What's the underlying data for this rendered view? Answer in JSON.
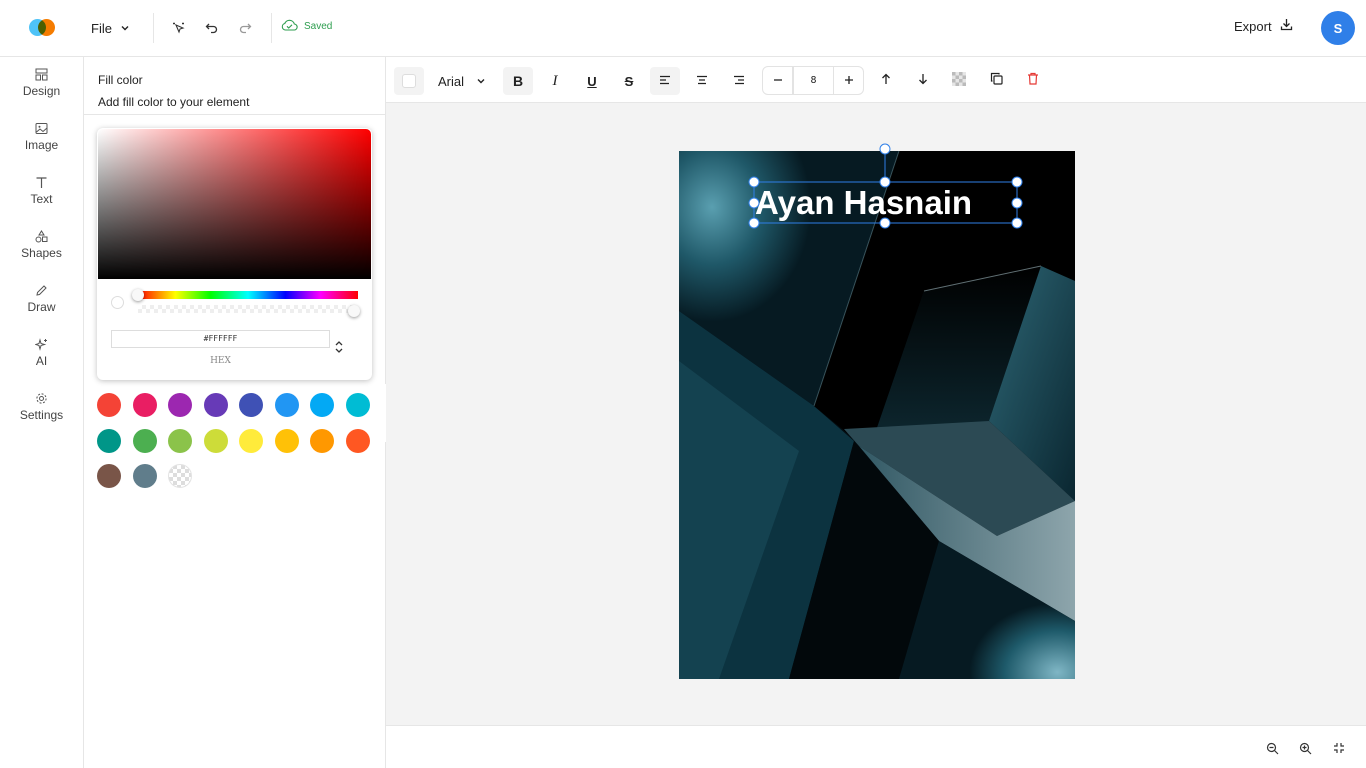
{
  "header": {
    "file_label": "File",
    "saved_label": "Saved",
    "export_label": "Export",
    "avatar_initial": "S"
  },
  "nav": {
    "items": [
      {
        "label": "Design",
        "icon": "layout-icon"
      },
      {
        "label": "Image",
        "icon": "image-icon"
      },
      {
        "label": "Text",
        "icon": "text-icon"
      },
      {
        "label": "Shapes",
        "icon": "shapes-icon"
      },
      {
        "label": "Draw",
        "icon": "pencil-icon"
      },
      {
        "label": "AI",
        "icon": "sparkles-icon"
      },
      {
        "label": "Settings",
        "icon": "gear-icon"
      }
    ]
  },
  "panel": {
    "title": "Fill color",
    "subtitle": "Add fill color to your element",
    "picker": {
      "hex_value": "#FFFFFF",
      "hex_label": "HEX",
      "hue_color": "#ff0000"
    },
    "swatches": [
      "#f44336",
      "#e91e63",
      "#9c27b0",
      "#673ab7",
      "#3f51b5",
      "#2196f3",
      "#03a9f4",
      "#00bcd4",
      "#009688",
      "#4caf50",
      "#8bc34a",
      "#cddc39",
      "#ffeb3b",
      "#ffc107",
      "#ff9800",
      "#ff5722",
      "#795548",
      "#607d8b",
      "transparent"
    ]
  },
  "toolbar": {
    "font_family": "Arial",
    "font_size": "8"
  },
  "canvas": {
    "text": "Ayan Hasnain",
    "text_color": "#ffffff",
    "selection_color": "#2f7fe8"
  }
}
